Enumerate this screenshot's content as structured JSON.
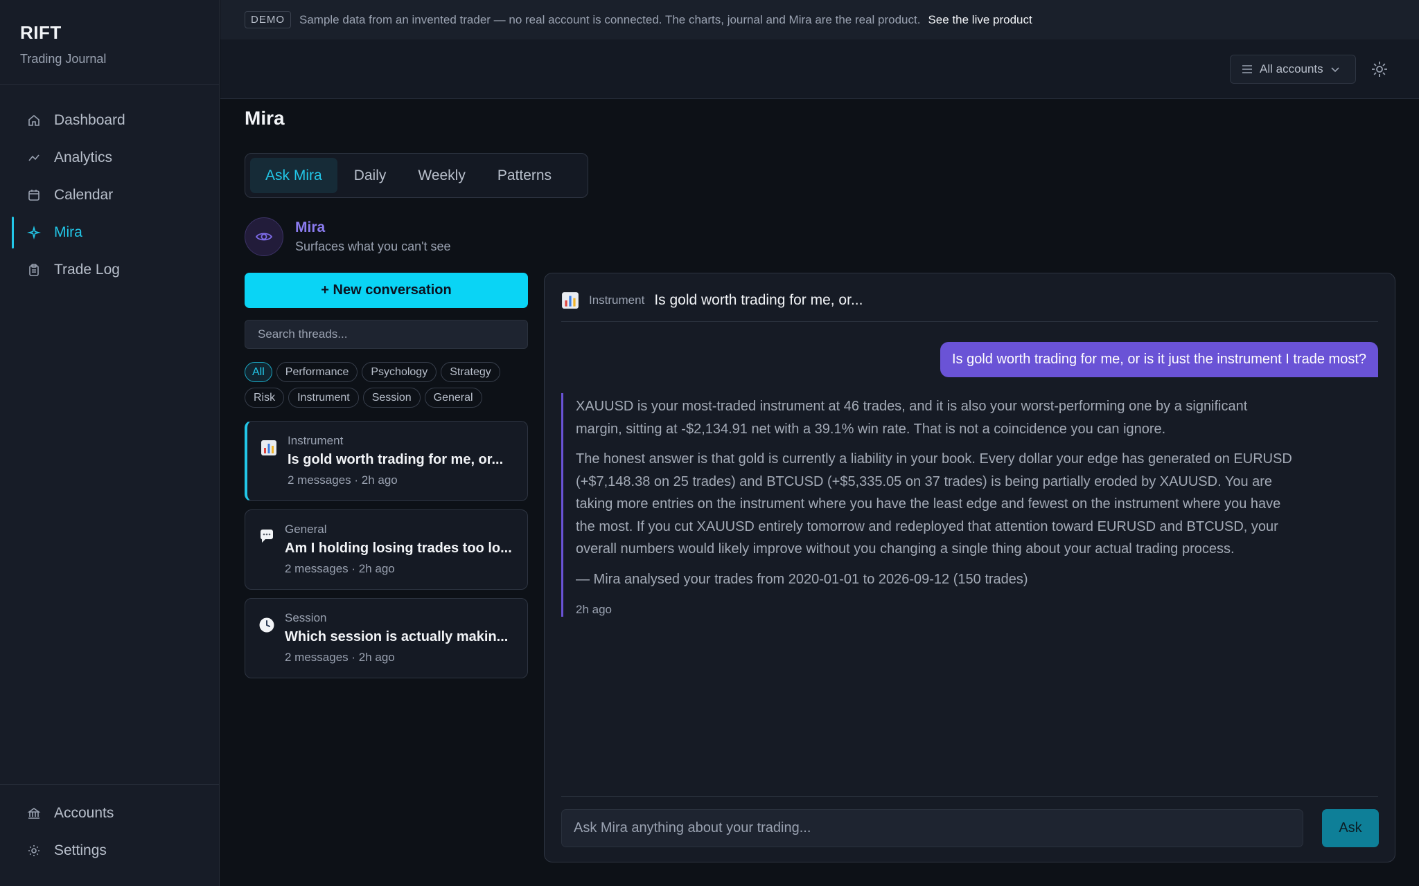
{
  "app": {
    "name": "RIFT",
    "subtitle": "Trading Journal"
  },
  "sidebar": {
    "items": [
      {
        "label": "Dashboard",
        "icon": "home-icon"
      },
      {
        "label": "Analytics",
        "icon": "chart-line-icon"
      },
      {
        "label": "Calendar",
        "icon": "calendar-icon"
      },
      {
        "label": "Mira",
        "icon": "sparkle-icon",
        "active": true
      },
      {
        "label": "Trade Log",
        "icon": "clipboard-icon"
      }
    ],
    "bottom": [
      {
        "label": "Accounts",
        "icon": "bank-icon"
      },
      {
        "label": "Settings",
        "icon": "gear-icon"
      }
    ]
  },
  "banner": {
    "badge": "DEMO",
    "text": "Sample data from an invented trader — no real account is connected. The charts, journal and Mira are the real product.",
    "link": "See the live product"
  },
  "topbar": {
    "account_select": "All accounts"
  },
  "page": {
    "title": "Mira",
    "tabs": [
      "Ask Mira",
      "Daily",
      "Weekly",
      "Patterns"
    ],
    "active_tab": "Ask Mira"
  },
  "mira": {
    "name": "Mira",
    "tagline": "Surfaces what you can't see"
  },
  "threads_panel": {
    "new_button": "+ New conversation",
    "search_placeholder": "Search threads...",
    "filters": [
      "All",
      "Performance",
      "Psychology",
      "Strategy",
      "Risk",
      "Instrument",
      "Session",
      "General"
    ],
    "active_filter": "All",
    "threads": [
      {
        "category": "Instrument",
        "title": "Is gold worth trading for me, or...",
        "meta": "2 messages · 2h ago",
        "icon": "bar-chart-icon"
      },
      {
        "category": "General",
        "title": "Am I holding losing trades too lo...",
        "meta": "2 messages · 2h ago",
        "icon": "speech-bubble-icon"
      },
      {
        "category": "Session",
        "title": "Which session is actually makin...",
        "meta": "2 messages · 2h ago",
        "icon": "clock-icon"
      }
    ]
  },
  "chat": {
    "category": "Instrument",
    "title": "Is gold worth trading for me, or...",
    "user_message": "Is gold worth trading for me, or is it just the instrument I trade most?",
    "ai_paragraphs": [
      "XAUUSD is your most-traded instrument at 46 trades, and it is also your worst-performing one by a significant margin, sitting at -$2,134.91 net with a 39.1% win rate. That is not a coincidence you can ignore.",
      "The honest answer is that gold is currently a liability in your book. Every dollar your edge has generated on EURUSD (+$7,148.38 on 25 trades) and BTCUSD (+$5,335.05 on 37 trades) is being partially eroded by XAUUSD. You are taking more entries on the instrument where you have the least edge and fewest on the instrument where you have the most. If you cut XAUUSD entirely tomorrow and redeployed that attention toward EURUSD and BTCUSD, your overall numbers would likely improve without you changing a single thing about your actual trading process.",
      "— Mira analysed your trades from 2020-01-01 to 2026-09-12 (150 trades)"
    ],
    "ai_time": "2h ago",
    "input_placeholder": "Ask Mira anything about your trading...",
    "ask_button": "Ask"
  },
  "colors": {
    "accent": "#22c7e8",
    "mira_purple": "#6a53d6",
    "background": "#0d1117",
    "sidebar": "#171c27"
  }
}
